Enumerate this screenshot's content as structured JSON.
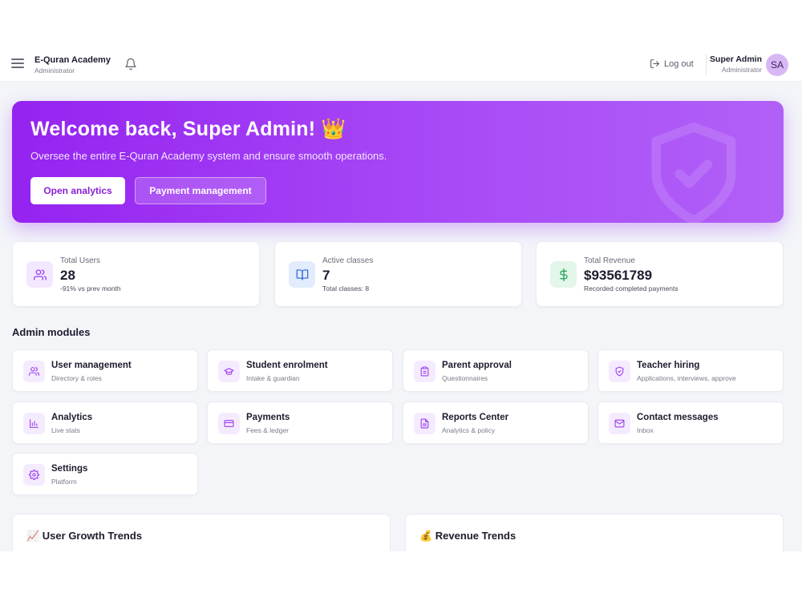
{
  "header": {
    "brand_title": "E-Quran Academy",
    "brand_subtitle": "Administrator",
    "logout_label": "Log out",
    "user_name": "Super Admin",
    "user_role": "Administrator",
    "avatar_initials": "SA"
  },
  "hero": {
    "title": "Welcome back, Super Admin! 👑",
    "subtitle": "Oversee the entire E-Quran Academy system and ensure smooth operations.",
    "primary_button": "Open analytics",
    "secondary_button": "Payment management"
  },
  "stats": [
    {
      "label": "Total Users",
      "value": "28",
      "note": "-91% vs prev month",
      "icon": "users-icon",
      "accent": "#9b3df0"
    },
    {
      "label": "Active classes",
      "value": "7",
      "note": "Total classes: 8",
      "icon": "book-open-icon",
      "accent": "#3b6fe0"
    },
    {
      "label": "Total Revenue",
      "value": "$93561789",
      "note": "Recorded completed payments",
      "icon": "dollar-icon",
      "accent": "#22a55b"
    }
  ],
  "modules": {
    "section_title": "Admin modules",
    "items": [
      {
        "title": "User management",
        "subtitle": "Directory & roles",
        "icon": "users-icon"
      },
      {
        "title": "Student enrolment",
        "subtitle": "Intake & guardian",
        "icon": "graduation-cap-icon"
      },
      {
        "title": "Parent approval",
        "subtitle": "Questionnaires",
        "icon": "clipboard-icon"
      },
      {
        "title": "Teacher hiring",
        "subtitle": "Applications, interviews, approve",
        "icon": "shield-check-icon"
      },
      {
        "title": "Analytics",
        "subtitle": "Live stats",
        "icon": "bar-chart-icon"
      },
      {
        "title": "Payments",
        "subtitle": "Fees & ledger",
        "icon": "credit-card-icon"
      },
      {
        "title": "Reports Center",
        "subtitle": "Analytics & policy",
        "icon": "file-text-icon"
      },
      {
        "title": "Contact messages",
        "subtitle": "Inbox",
        "icon": "mail-icon"
      },
      {
        "title": "Settings",
        "subtitle": "Platform",
        "icon": "gear-icon"
      }
    ]
  },
  "charts": {
    "growth_title": "📈 User Growth Trends",
    "revenue_title": "💰 Revenue Trends"
  },
  "colors": {
    "accent": "#9b3df0",
    "hero_gradient_start": "#9523f0",
    "hero_gradient_end": "#b160f7"
  }
}
